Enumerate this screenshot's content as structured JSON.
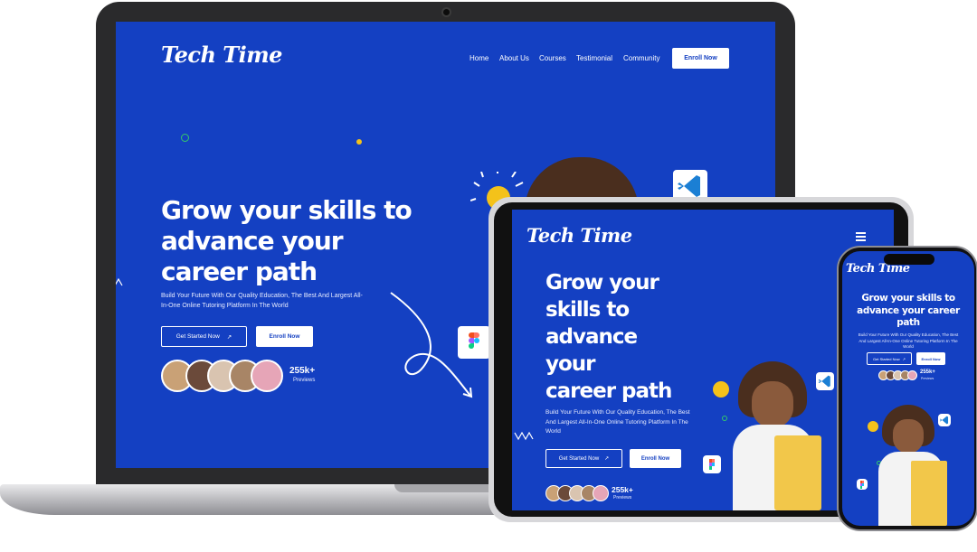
{
  "site": {
    "logo": "Tech Time",
    "nav": [
      "Home",
      "About Us",
      "Courses",
      "Testimonial",
      "Community"
    ],
    "nav_cta": "Enroll Now",
    "headline": "Grow your skills to advance your career path",
    "headline_lines_laptop": [
      "Grow your skills to",
      "advance your",
      "career path"
    ],
    "headline_lines_tablet": [
      "Grow your",
      "skills to",
      "advance",
      "your",
      "career path"
    ],
    "headline_lines_phone": [
      "Grow your skills to",
      "advance your career",
      "path"
    ],
    "subtext": "Build Your Future With Our Quality Education, The Best And Largest All-In-One Online Tutoring Platform In The World",
    "subtext_lines_laptop": [
      "Build Your Future With Our Quality Education, The Best And Largest All-",
      "In-One Online Tutoring Platform In The World"
    ],
    "subtext_lines_tablet": [
      "Build Your Future With Our Quality Education, The Best",
      "And Largest All-In-One Online Tutoring Platform In The",
      "World"
    ],
    "subtext_lines_phone": [
      "Build Your Future With Our Quality Education, The Best",
      "And Largest All-In-One Online Tutoring Platform In The",
      "World"
    ],
    "primary_button": "Get Started Now",
    "secondary_button": "Enroll Now",
    "stat_value": "255k+",
    "stat_label": "Previews"
  },
  "colors": {
    "brand_blue": "#1440c2",
    "white": "#ffffff",
    "accent_yellow": "#f4c21a",
    "accent_green": "#34c96a"
  },
  "icons": [
    "vscode-icon",
    "figma-icon",
    "lightbulb-icon",
    "arrow-up-right-icon",
    "hamburger-menu-icon"
  ]
}
